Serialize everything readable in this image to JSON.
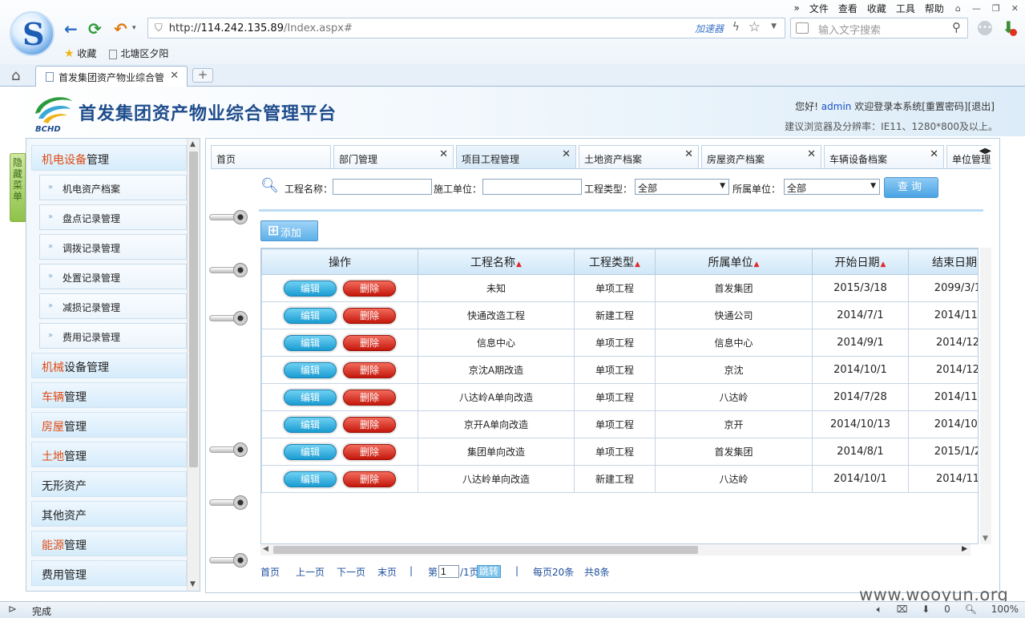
{
  "browser": {
    "menu": [
      "文件",
      "查看",
      "收藏",
      "工具",
      "帮助"
    ],
    "url_prefix": "http://",
    "url_host": "114.242.135.89",
    "url_path": "/Index.aspx#",
    "accelerator": "加速器",
    "search_placeholder": "输入文字搜索",
    "favorites": [
      "收藏",
      "北塘区夕阳"
    ],
    "tab_title": "首发集团资产物业综合管",
    "status_text": "完成",
    "status_right": [
      "0",
      "100%"
    ]
  },
  "app": {
    "logo_text": "BCHD",
    "title_part1": "首发集团资产物业",
    "title_part2": "综合管理平台",
    "welcome_pre": "您好!",
    "user": "admin",
    "welcome_post": "欢迎登录本系统",
    "reset_pwd": "[重置密码]",
    "logout": "[退出]",
    "hint": "建议浏览器及分辨率：IE11、1280*800及以上。",
    "hide_menu": "隐藏菜单"
  },
  "sidebar": {
    "sections": [
      {
        "hl": "机电设备",
        "rest": "管理",
        "subs": [
          "机电资产档案",
          "盘点记录管理",
          "调拨记录管理",
          "处置记录管理",
          "减损记录管理",
          "费用记录管理"
        ]
      },
      {
        "hl": "机械",
        "rest": "设备管理"
      },
      {
        "hl": "车辆",
        "rest": "管理"
      },
      {
        "hl": "房屋",
        "rest": "管理"
      },
      {
        "hl": "土地",
        "rest": "管理"
      },
      {
        "hl": "",
        "rest": "无形资产"
      },
      {
        "hl": "",
        "rest": "其他资产"
      },
      {
        "hl": "能源",
        "rest": "管理"
      },
      {
        "hl": "",
        "rest": "费用管理"
      }
    ]
  },
  "content_tabs": [
    "首页",
    "部门管理",
    "项目工程管理",
    "土地资产档案",
    "房屋资产档案",
    "车辆设备档案",
    "单位管理"
  ],
  "query": {
    "name_label": "工程名称：",
    "unit_label": "施工单位：",
    "type_label": "工程类型：",
    "type_value": "全部",
    "org_label": "所属单位：",
    "org_value": "全部",
    "search_btn": "查询"
  },
  "add_btn": "添加",
  "grid": {
    "headers": [
      "操作",
      "工程名称",
      "工程类型",
      "所属单位",
      "开始日期",
      "结束日期"
    ],
    "edit_label": "编辑",
    "delete_label": "删除",
    "rows": [
      [
        "未知",
        "单项工程",
        "首发集团",
        "2015/3/18",
        "2099/3/1"
      ],
      [
        "快通改造工程",
        "新建工程",
        "快通公司",
        "2014/7/1",
        "2014/11/"
      ],
      [
        "信息中心",
        "单项工程",
        "信息中心",
        "2014/9/1",
        "2014/12"
      ],
      [
        "京沈A期改造",
        "单项工程",
        "京沈",
        "2014/10/1",
        "2014/12"
      ],
      [
        "八达岭A单向改造",
        "单项工程",
        "八达岭",
        "2014/7/28",
        "2014/11/"
      ],
      [
        "京开A单向改造",
        "单项工程",
        "京开",
        "2014/10/13",
        "2014/10/"
      ],
      [
        "集团单向改造",
        "单项工程",
        "首发集团",
        "2014/8/1",
        "2015/1/2"
      ],
      [
        "八达岭单向改造",
        "新建工程",
        "八达岭",
        "2014/10/1",
        "2014/11"
      ]
    ]
  },
  "pager": {
    "first": "首页",
    "prev": "上一页",
    "next": "下一页",
    "last": "末页",
    "sep": "|",
    "page_pre": "第",
    "page_value": "1",
    "page_post": "/1页",
    "jump": "跳转",
    "per_page": "每页20条",
    "total": "共8条"
  },
  "watermark": "www.wooyun.org"
}
